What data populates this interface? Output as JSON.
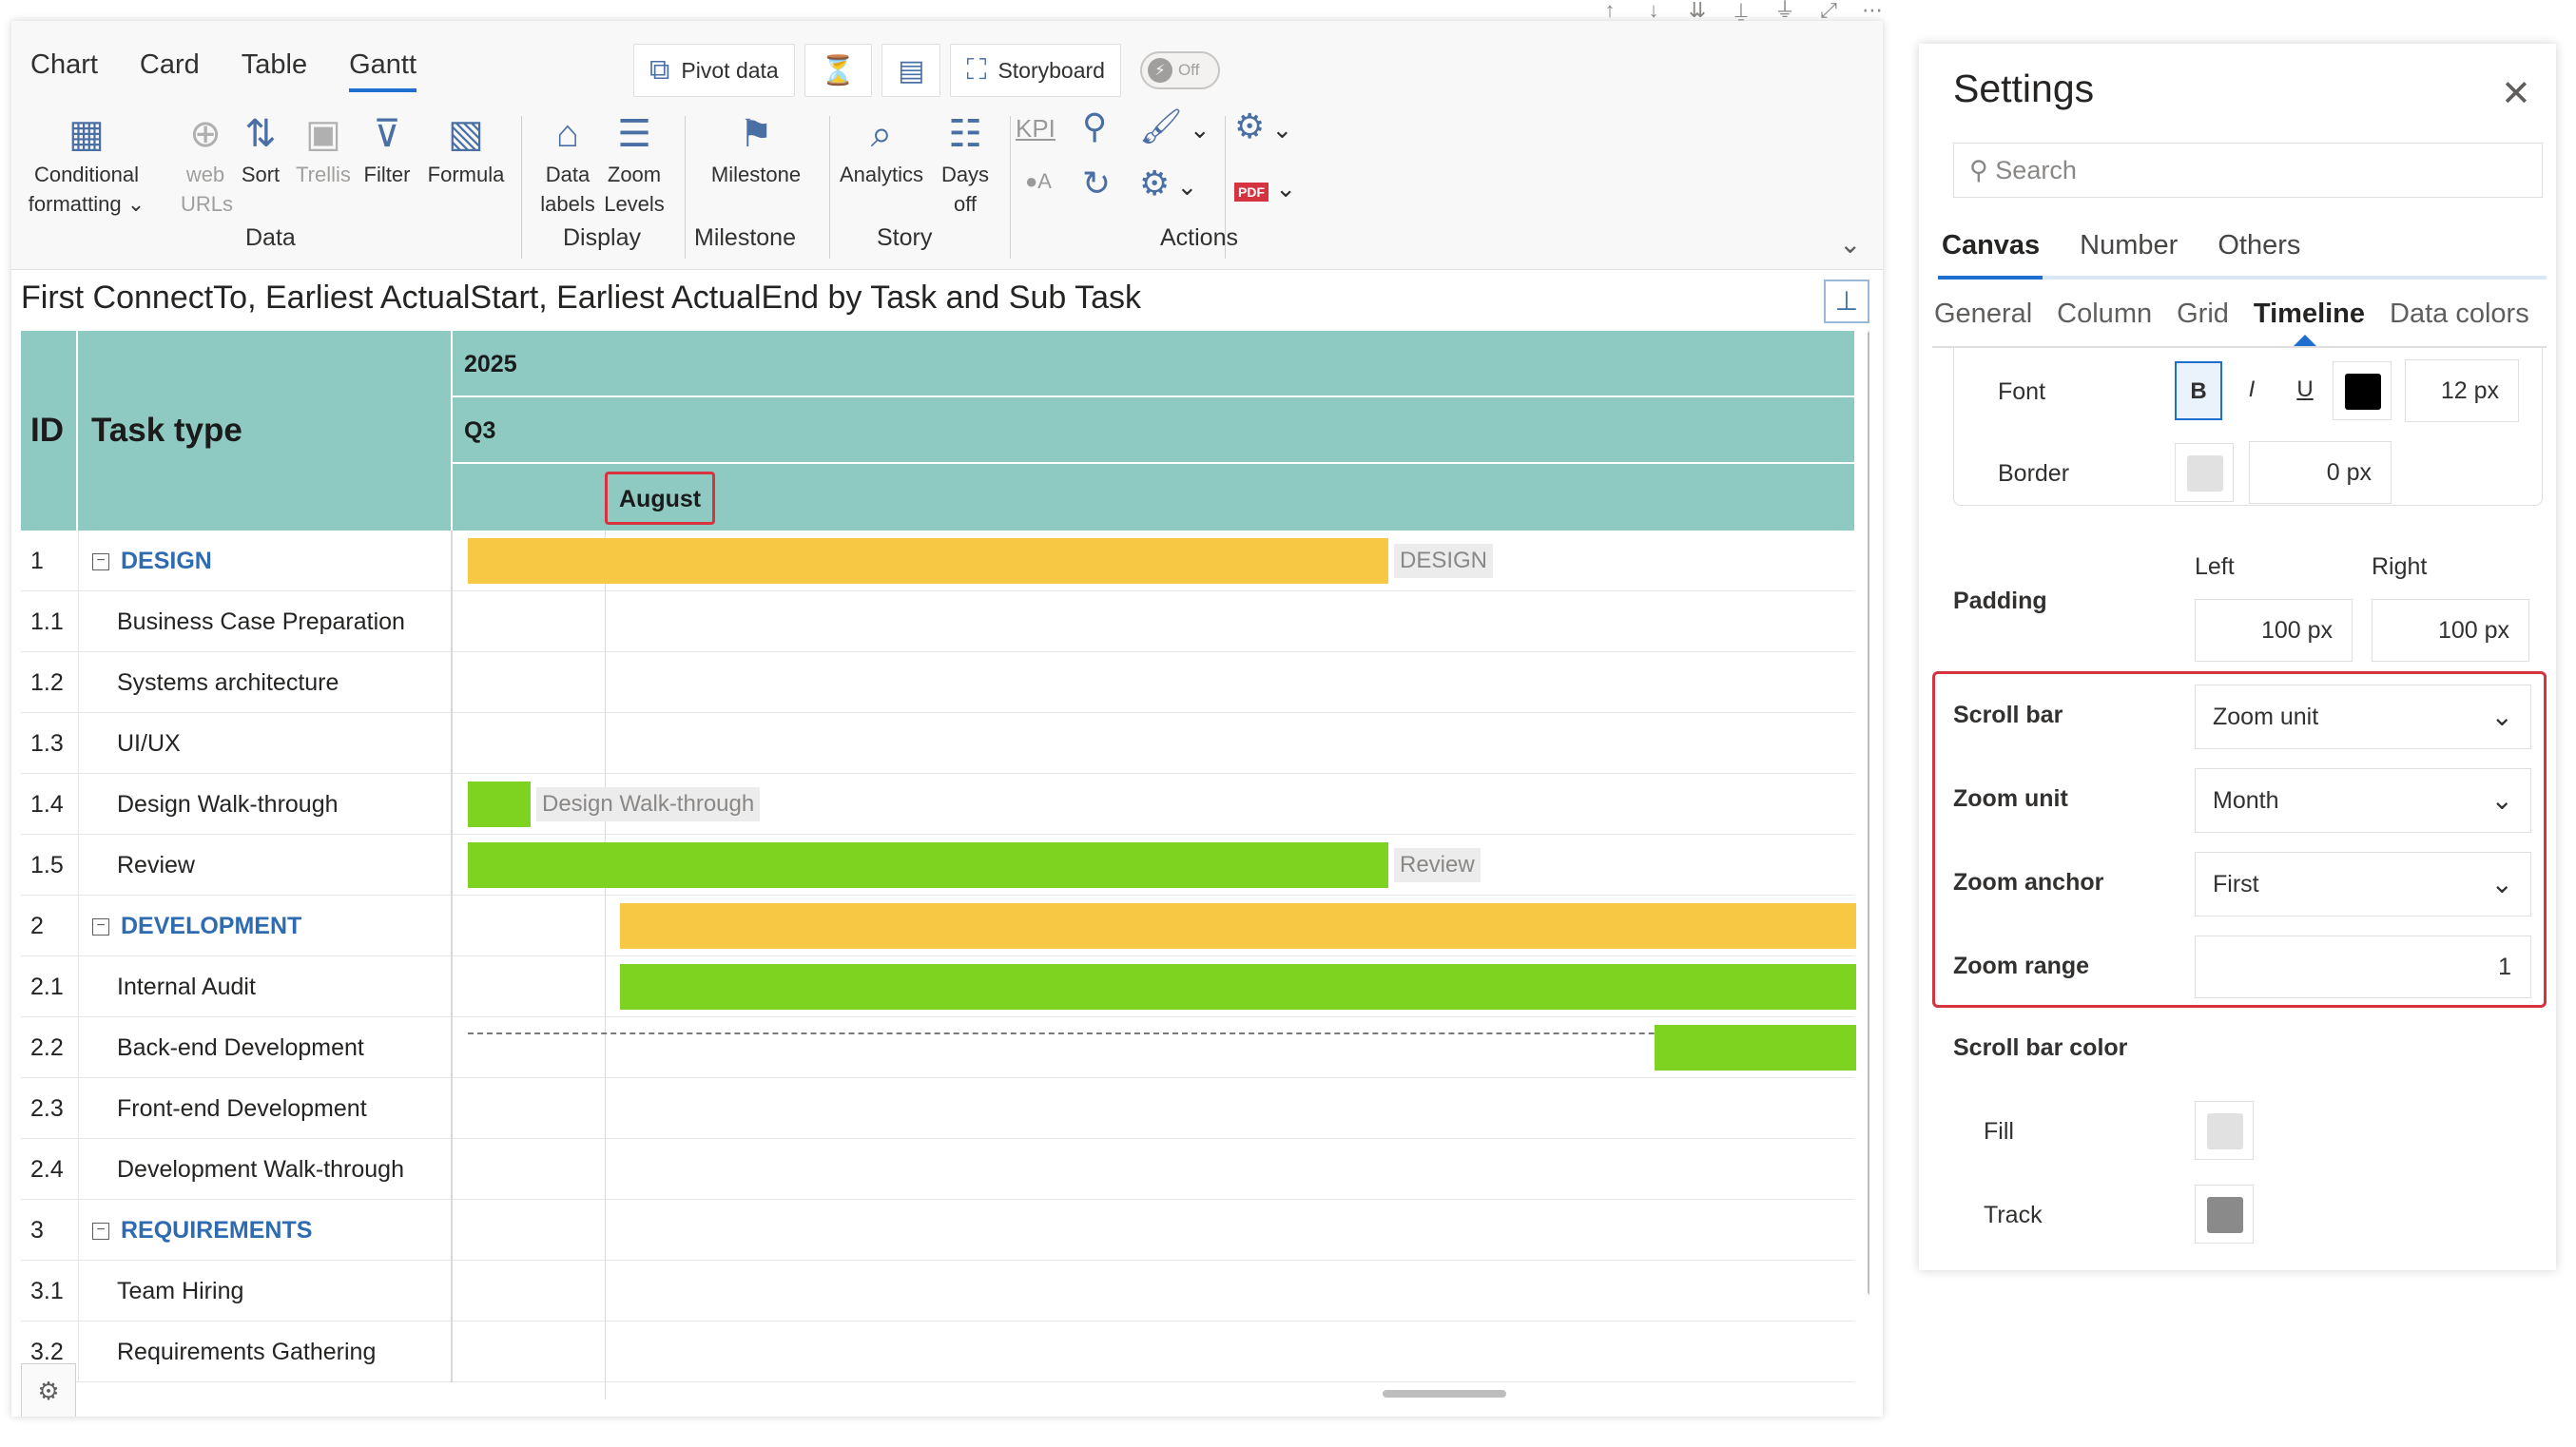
{
  "toolbar": {
    "tabs": [
      "Chart",
      "Card",
      "Table",
      "Gantt"
    ],
    "pivot_label": "Pivot data",
    "storyboard_label": "Storyboard",
    "toggle_label": "Off",
    "conditional_formatting": "Conditional",
    "conditional_formatting2": "formatting",
    "web_urls": "web",
    "web_urls2": "URLs",
    "sort": "Sort",
    "trellis": "Trellis",
    "filter": "Filter",
    "formula": "Formula",
    "data_labels": "Data",
    "data_labels2": "labels",
    "zoom_levels": "Zoom",
    "zoom_levels2": "Levels",
    "milestone": "Milestone",
    "analytics": "Analytics",
    "days_off": "Days",
    "days_off2": "off",
    "kpi": "KPI",
    "pdf": "PDF",
    "groups": {
      "data": "Data",
      "display": "Display",
      "milestone": "Milestone",
      "story": "Story",
      "actions": "Actions"
    }
  },
  "chart": {
    "title": "First ConnectTo, Earliest ActualStart, Earliest ActualEnd by Task and Sub Task",
    "header": {
      "id": "ID",
      "task_type": "Task type",
      "year": "2025",
      "quarter": "Q3",
      "month": "August"
    },
    "rows": [
      {
        "id": "1",
        "name": "DESIGN",
        "parent": true
      },
      {
        "id": "1.1",
        "name": "Business Case Preparation",
        "parent": false
      },
      {
        "id": "1.2",
        "name": "Systems architecture",
        "parent": false
      },
      {
        "id": "1.3",
        "name": "UI/UX",
        "parent": false
      },
      {
        "id": "1.4",
        "name": "Design Walk-through",
        "parent": false
      },
      {
        "id": "1.5",
        "name": "Review",
        "parent": false
      },
      {
        "id": "2",
        "name": "DEVELOPMENT",
        "parent": true
      },
      {
        "id": "2.1",
        "name": "Internal Audit",
        "parent": false
      },
      {
        "id": "2.2",
        "name": "Back-end Development",
        "parent": false
      },
      {
        "id": "2.3",
        "name": "Front-end Development",
        "parent": false
      },
      {
        "id": "2.4",
        "name": "Development Walk-through",
        "parent": false
      },
      {
        "id": "3",
        "name": "REQUIREMENTS",
        "parent": true
      },
      {
        "id": "3.1",
        "name": "Team Hiring",
        "parent": false
      },
      {
        "id": "3.2",
        "name": "Requirements Gathering",
        "parent": false
      }
    ],
    "bar_labels": {
      "design": "DESIGN",
      "design_walkthrough": "Design Walk-through",
      "review": "Review"
    },
    "colors": {
      "header": "#8fcac2",
      "parent_bar": "#f7c844",
      "child_bar": "#7ed321",
      "parent_text": "#2e6bb0"
    }
  },
  "settings": {
    "title": "Settings",
    "search_placeholder": "Search",
    "tabs": [
      "Canvas",
      "Number",
      "Others"
    ],
    "subtabs": [
      "General",
      "Column",
      "Grid",
      "Timeline",
      "Data colors"
    ],
    "font_label": "Font",
    "bold": "B",
    "italic": "I",
    "underline": "U",
    "font_size": "12  px",
    "border_label": "Border",
    "border_width": "0  px",
    "padding_label": "Padding",
    "left_label": "Left",
    "right_label": "Right",
    "padding_left": "100  px",
    "padding_right": "100  px",
    "scroll_bar_label": "Scroll bar",
    "scroll_bar_value": "Zoom unit",
    "zoom_unit_label": "Zoom unit",
    "zoom_unit_value": "Month",
    "zoom_anchor_label": "Zoom anchor",
    "zoom_anchor_value": "First",
    "zoom_range_label": "Zoom range",
    "zoom_range_value": "1",
    "scroll_bar_color_label": "Scroll bar color",
    "fill_label": "Fill",
    "track_label": "Track",
    "colors": {
      "font_color": "#000000",
      "border_color": "#e1e1e1",
      "fill_color": "#e1e1e1",
      "track_color": "#8a8a8a",
      "highlight": "#d4333f"
    }
  }
}
